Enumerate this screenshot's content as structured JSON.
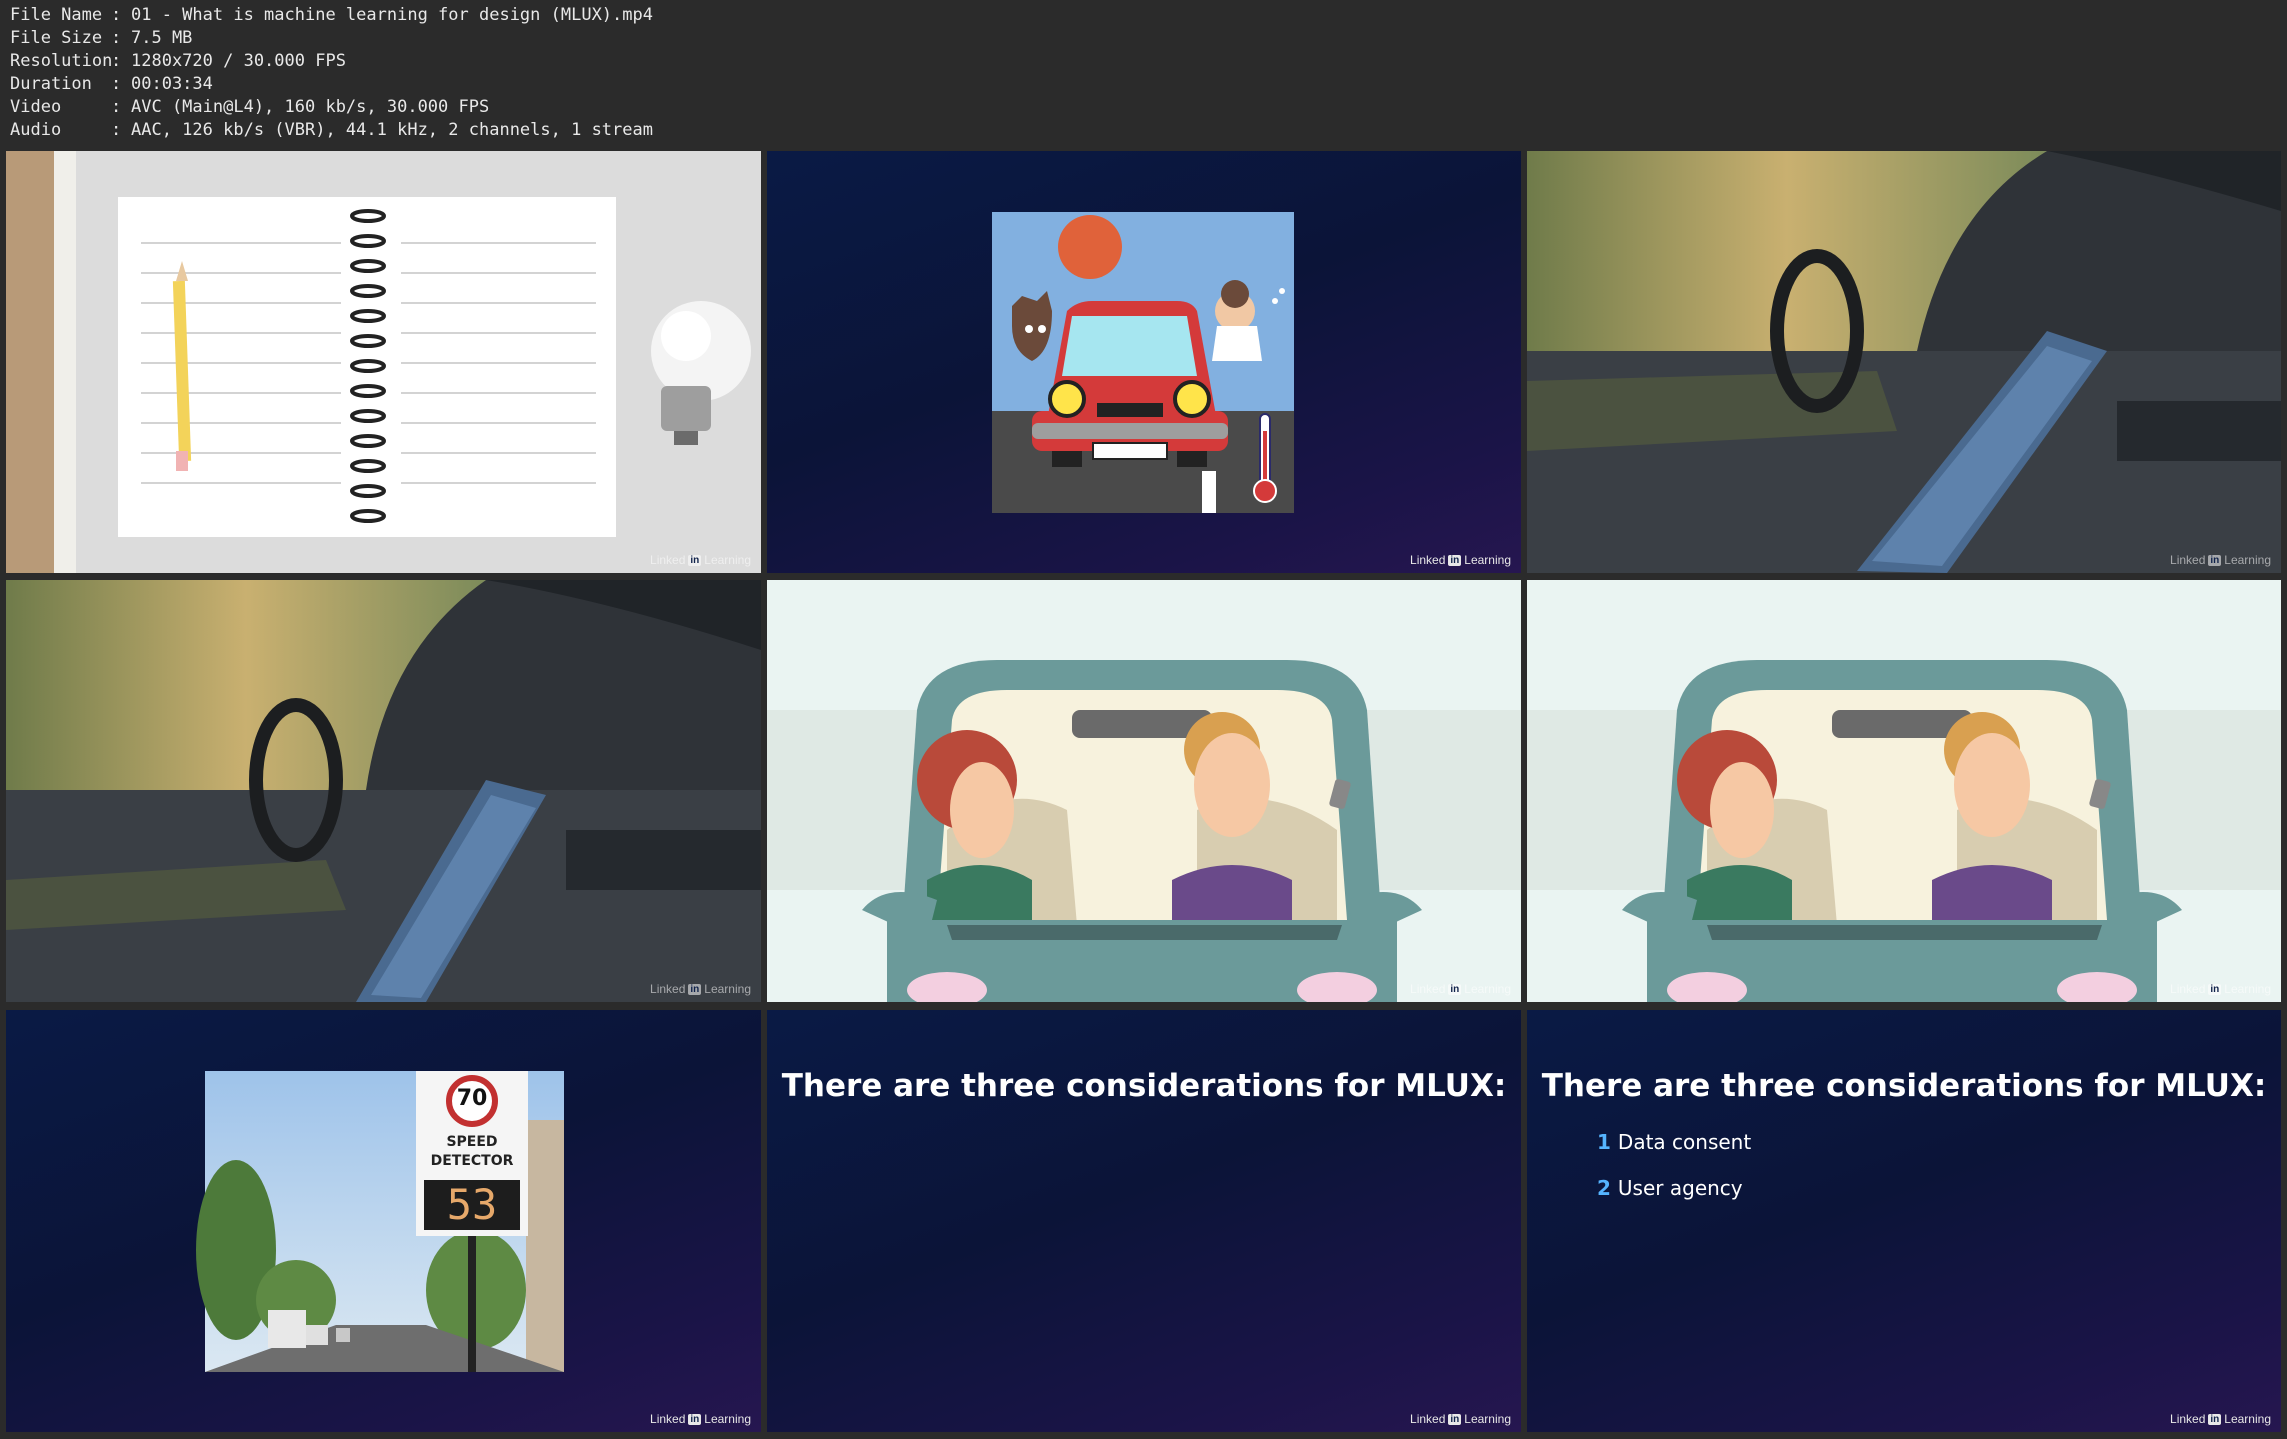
{
  "file_info": [
    {
      "key": "File Name",
      "value": "01 - What is machine learning for design (MLUX).mp4"
    },
    {
      "key": "File Size",
      "value": "7.5 MB"
    },
    {
      "key": "Resolution",
      "value": "1280x720 / 30.000 FPS"
    },
    {
      "key": "Duration",
      "value": "00:03:34"
    },
    {
      "key": "Video",
      "value": "AVC (Main@L4), 160 kb/s, 30.000 FPS"
    },
    {
      "key": "Audio",
      "value": "AAC, 126 kb/s (VBR), 44.1 kHz, 2 channels, 1 stream"
    }
  ],
  "separator": ":",
  "watermark": {
    "brand_a": "Linked",
    "brand_b": "in",
    "brand_c": "Learning"
  },
  "speed_sign": {
    "limit": "70",
    "label_line1": "SPEED",
    "label_line2": "DETECTOR",
    "reading": "53"
  },
  "slide_title": "There are three considerations for MLUX:",
  "considerations": [
    {
      "num": "1",
      "label": "Data consent"
    },
    {
      "num": "2",
      "label": "User agency"
    }
  ],
  "thumbnails": [
    {
      "icon": "notebook-pencil-bulb-photo"
    },
    {
      "icon": "hot-car-cartoon"
    },
    {
      "icon": "driver-touchscreen-photo"
    },
    {
      "icon": "driver-touchscreen-photo"
    },
    {
      "icon": "distracted-drivers-cartoon"
    },
    {
      "icon": "distracted-drivers-cartoon"
    },
    {
      "icon": "speed-detector-photo"
    },
    {
      "icon": "title-slide"
    },
    {
      "icon": "considerations-slide"
    }
  ]
}
